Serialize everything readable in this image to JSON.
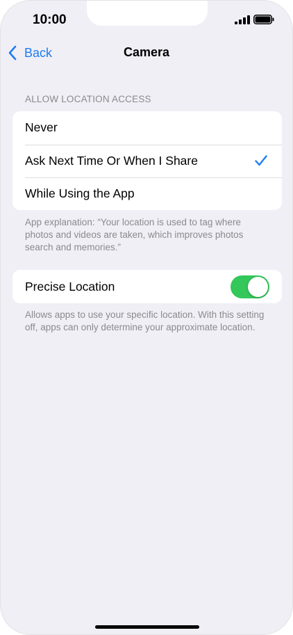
{
  "status_bar": {
    "time": "10:00",
    "icons": [
      "cellular-signal-icon",
      "battery-icon"
    ]
  },
  "nav": {
    "back_label": "Back",
    "title": "Camera",
    "back_icon": "chevron-left-icon"
  },
  "location_access": {
    "header": "ALLOW LOCATION ACCESS",
    "options": [
      {
        "label": "Never",
        "selected": false
      },
      {
        "label": "Ask Next Time Or When I Share",
        "selected": true
      },
      {
        "label": "While Using the App",
        "selected": false
      }
    ],
    "footnote": "App explanation: “Your location is used to tag where photos and videos are taken, which improves photos search and memories.”"
  },
  "precise_location": {
    "label": "Precise Location",
    "enabled": true,
    "footnote": "Allows apps to use your specific location. With this setting off, apps can only determine your approximate location."
  },
  "colors": {
    "accent": "#1e7cf2",
    "toggle_on": "#34c759",
    "background": "#f0eff5",
    "secondary_text": "#8a8a8e"
  }
}
